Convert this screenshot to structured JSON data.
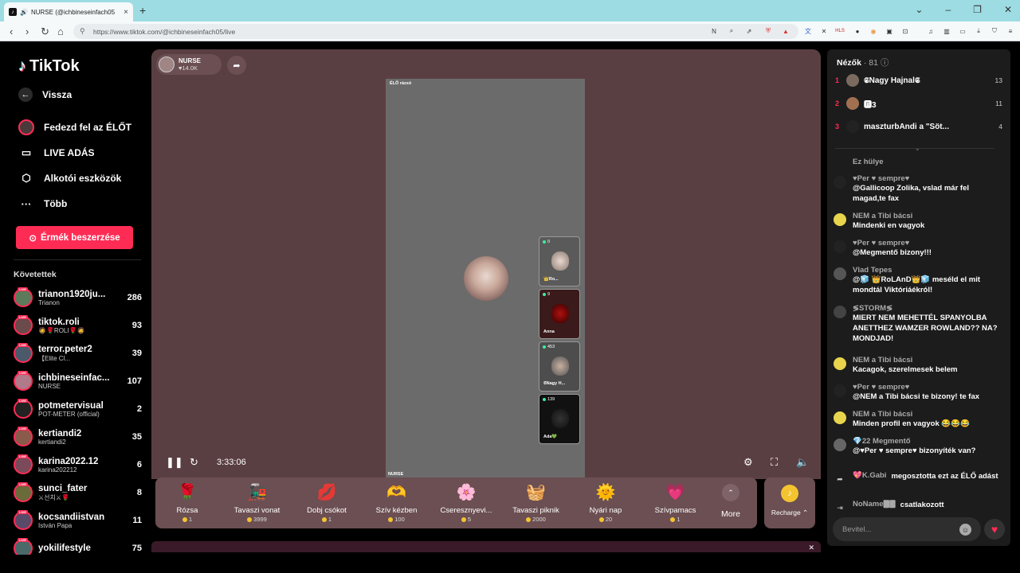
{
  "browser": {
    "tab_title": "NURSE (@ichbineseinfach05",
    "url": "https://www.tiktok.com/@ichbineseinfach05/live"
  },
  "sidebar": {
    "logo": "TikTok",
    "back": "Vissza",
    "nav": [
      "Fedezd fel az ÉLŐT",
      "LIVE ADÁS",
      "Alkotói eszközök",
      "Több"
    ],
    "coin_button": "Érmék beszerzése",
    "following_title": "Követettek",
    "following": [
      {
        "name": "trianon1920ju...",
        "sub": "Trianon",
        "count": "286"
      },
      {
        "name": "tiktok.roli",
        "sub": "🧔🌹ROLI🌹🧔",
        "count": "93"
      },
      {
        "name": "terror.peter2",
        "sub": "【Elite Cl...",
        "count": "39"
      },
      {
        "name": "ichbineseinfac...",
        "sub": "NURSE",
        "count": "107"
      },
      {
        "name": "potmetervisual",
        "sub": "POT-METER (official)",
        "count": "2"
      },
      {
        "name": "kertiandi2",
        "sub": "kertiandi2",
        "count": "35"
      },
      {
        "name": "karina2022.12",
        "sub": "karina202212",
        "count": "6"
      },
      {
        "name": "sunci_fater",
        "sub": "⚔선치⚔🌹",
        "count": "8"
      },
      {
        "name": "kocsandiistvan",
        "sub": "István Papa",
        "count": "11"
      },
      {
        "name": "yokilifestyle",
        "sub": "",
        "count": "75"
      }
    ]
  },
  "player": {
    "host_name": "NURSE",
    "host_likes": "♥14.0K",
    "live_badge": "ÉLŐ rázsó",
    "watermark": "NURSE",
    "timer": "3:33:06",
    "guests": [
      {
        "count": "0",
        "name": "👑Ro..."
      },
      {
        "count": "9",
        "name": "Anna"
      },
      {
        "count": "453",
        "name": "𝕾Nagy H..."
      },
      {
        "count": "139",
        "name": "Ada💚"
      }
    ]
  },
  "gifts": [
    {
      "name": "Rózsa",
      "price": "1",
      "icon": "🌹"
    },
    {
      "name": "Tavaszi vonat",
      "price": "3999",
      "icon": "🚂"
    },
    {
      "name": "Dobj csókot",
      "price": "1",
      "icon": "💋"
    },
    {
      "name": "Szív kézben",
      "price": "100",
      "icon": "🫶"
    },
    {
      "name": "Cseresznyevi...",
      "price": "5",
      "icon": "🌸"
    },
    {
      "name": "Tavaszi piknik",
      "price": "2000",
      "icon": "🧺"
    },
    {
      "name": "Nyári nap",
      "price": "20",
      "icon": "🌞"
    },
    {
      "name": "Szívpamacs",
      "price": "1",
      "icon": "💗"
    }
  ],
  "gift_more": "More",
  "recharge": "Recharge ⌃",
  "chat": {
    "viewers_label": "Nézők",
    "viewers_count": "· 81",
    "top_viewers": [
      {
        "rank": "1",
        "name": "𝕾Nagy Hajnal𝕾",
        "score": "13"
      },
      {
        "rank": "2",
        "name": "🅱3",
        "score": "11"
      },
      {
        "rank": "3",
        "name": "maszturbAndi a \"Söt...",
        "score": "4"
      }
    ],
    "messages": [
      {
        "user": "",
        "text": "Ez hülye"
      },
      {
        "user": "♥Per ♥ sempre♥",
        "text": "@Gallicoop Zolika, vslad már fel magad,te fax"
      },
      {
        "user": "NEM a Tibi bácsi",
        "text": "Mindenki en vagyok"
      },
      {
        "user": "♥Per ♥ sempre♥",
        "text": "@Megmentő bizony!!!"
      },
      {
        "user": "Vlad Tepes",
        "text": "@🧊 👑RoLAnD👑🧊 meséld el mit mondtál Viktóriáékról!"
      },
      {
        "user": "≶STORM≶",
        "text": "MIERT NEM MEHETTÉL SPANYOLBA ANETTHEZ WAMZER ROWLAND?? NA? MONDJAD!"
      },
      {
        "user": "NEM a Tibi bácsi",
        "text": "Kacagok, szerelmesek belem"
      },
      {
        "user": "♥Per ♥ sempre♥",
        "text": "@NEM a Tibi bácsi te bizony! te fax"
      },
      {
        "user": "NEM a Tibi bácsi",
        "text": "Minden profil en vagyok 😂😂😂"
      },
      {
        "user": "💎22 Megmentő",
        "text": "@♥Per ♥ sempre♥ bizonyíték van?"
      },
      {
        "user": "💖K.Gabi",
        "text": "megosztotta ezt az ÉLŐ adást"
      },
      {
        "user": "NoName🀫🀫",
        "text": "csatlakozott"
      }
    ],
    "input_placeholder": "Bevitel..."
  }
}
